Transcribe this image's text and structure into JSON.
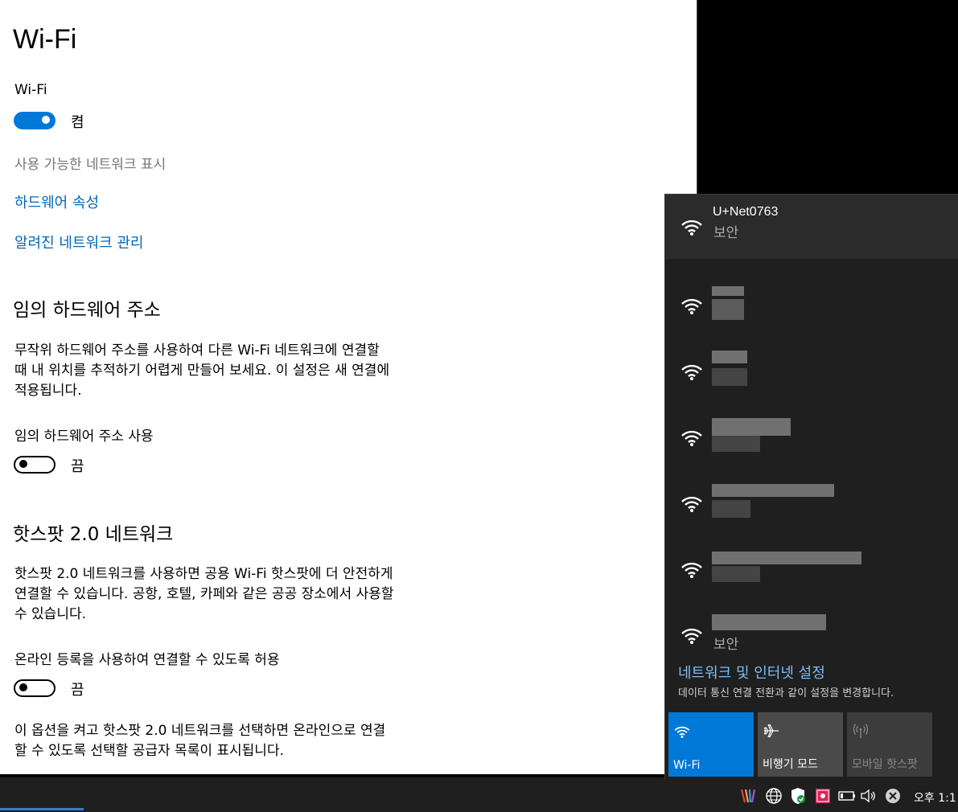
{
  "settings": {
    "title": "Wi-Fi",
    "wifi_label": "Wi-Fi",
    "wifi_toggle_state": "켬",
    "show_networks": "사용 가능한 네트워크 표시",
    "hardware_props": "하드웨어 속성",
    "manage_known": "알려진 네트워크 관리",
    "random_hw": {
      "heading": "임의 하드웨어 주소",
      "line1": "무작위 하드웨어 주소를 사용하여 다른 Wi-Fi 네트워크에 연결할",
      "line2": "때 내 위치를 추적하기 어렵게 만들어 보세요. 이 설정은 새 연결에",
      "line3": "적용됩니다.",
      "toggle_label": "임의 하드웨어 주소 사용",
      "toggle_state": "끔"
    },
    "hotspot": {
      "heading": "핫스팟 2.0 네트워크",
      "line1": "핫스팟 2.0 네트워크를 사용하면 공용 Wi-Fi 핫스팟에 더 안전하게",
      "line2": "연결할 수 있습니다. 공항, 호텔, 카페와 같은 공공 장소에서 사용할",
      "line3": "수 있습니다.",
      "toggle_label": "온라인 등록을 사용하여 연결할 수 있도록 허용",
      "toggle_state": "끔",
      "footer1": "이 옵션을 켜고 핫스팟 2.0 네트워크를 선택하면 온라인으로 연결",
      "footer2": "할 수 있도록 선택할 공급자 목록이 표시됩니다."
    }
  },
  "flyout": {
    "networks": [
      {
        "ssid": "U+Net0763",
        "status": "보안"
      },
      {
        "ssid": "",
        "status": ""
      },
      {
        "ssid": "",
        "status": ""
      },
      {
        "ssid": "",
        "status": ""
      },
      {
        "ssid": "",
        "status": ""
      },
      {
        "ssid": "",
        "status": ""
      },
      {
        "ssid": "",
        "status": "보안"
      }
    ],
    "settings_link": "네트워크 및 인터넷 설정",
    "settings_desc": "데이터 통신 연결 전환과 같이 설정을 변경합니다.",
    "quick_actions": [
      {
        "label": "Wi-Fi",
        "icon": "wifi-icon",
        "active": true
      },
      {
        "label": "비행기 모드",
        "icon": "airplane-icon",
        "active": false
      },
      {
        "label": "모바일 핫스팟",
        "icon": "hotspot-icon",
        "active": false
      }
    ]
  },
  "taskbar": {
    "clock": "오후 1:1",
    "tray_icons": [
      "pen-app-icon",
      "globe-icon",
      "shield-icon",
      "app-icon",
      "battery-icon",
      "volume-icon",
      "close-circle-icon"
    ]
  },
  "colors": {
    "accent": "#0078d7",
    "link": "#0067b8",
    "flyout_bg": "#1f1f1f",
    "flyout_link": "#7cbdf7"
  }
}
